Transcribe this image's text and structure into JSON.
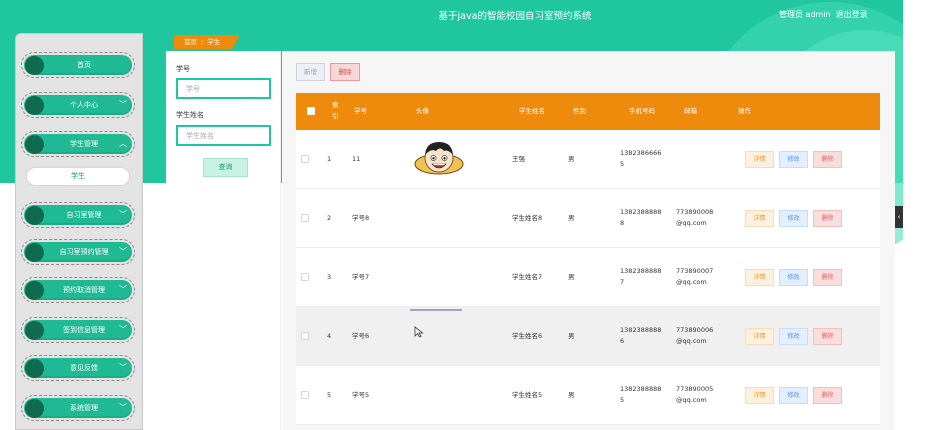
{
  "header": {
    "title": "基于java的智能校园自习室预约系统",
    "user_role": "管理员 admin",
    "logout_label": "退出登录"
  },
  "sidebar": {
    "items": [
      {
        "label": "首页",
        "has_arrow": false
      },
      {
        "label": "个人中心",
        "has_arrow": true
      },
      {
        "label": "学生管理",
        "has_arrow": true,
        "expanded": true
      },
      {
        "label": "自习室管理",
        "has_arrow": true
      },
      {
        "label": "自习室预约管理",
        "has_arrow": true
      },
      {
        "label": "预约取消管理",
        "has_arrow": true
      },
      {
        "label": "签到信息管理",
        "has_arrow": true
      },
      {
        "label": "意见反馈",
        "has_arrow": true
      },
      {
        "label": "系统管理",
        "has_arrow": true
      }
    ],
    "sub_item_label": "学生"
  },
  "breadcrumb": {
    "home": "首页",
    "separator": ":",
    "current": "学生"
  },
  "search": {
    "student_no_label": "学号",
    "student_no_placeholder": "学号",
    "student_name_label": "学生姓名",
    "student_name_placeholder": "学生姓名",
    "query_button": "查询"
  },
  "toolbar": {
    "add_label": "新增",
    "delete_label": "删除"
  },
  "table": {
    "headers": {
      "index": "索引",
      "student_no": "学号",
      "avatar": "头像",
      "student_name": "学生姓名",
      "gender": "性别",
      "phone": "手机号码",
      "email": "邮箱",
      "actions": "操作"
    },
    "action_labels": {
      "detail": "详情",
      "edit": "修改",
      "delete": "删除"
    },
    "rows": [
      {
        "index": "1",
        "student_no": "11",
        "student_name": "王强",
        "gender": "男",
        "phone_1": "1382386666",
        "phone_2": "5",
        "email_1": "",
        "email_2": ""
      },
      {
        "index": "2",
        "student_no": "学号8",
        "student_name": "学生姓名8",
        "gender": "男",
        "phone_1": "1382388888",
        "phone_2": "8",
        "email_1": "773890008",
        "email_2": "@qq.com"
      },
      {
        "index": "3",
        "student_no": "学号7",
        "student_name": "学生姓名7",
        "gender": "男",
        "phone_1": "1382388888",
        "phone_2": "7",
        "email_1": "773890007",
        "email_2": "@qq.com"
      },
      {
        "index": "4",
        "student_no": "学号6",
        "student_name": "学生姓名6",
        "gender": "男",
        "phone_1": "1382388888",
        "phone_2": "6",
        "email_1": "773890006",
        "email_2": "@qq.com"
      },
      {
        "index": "5",
        "student_no": "学号5",
        "student_name": "学生姓名5",
        "gender": "男",
        "phone_1": "1382388888",
        "phone_2": "5",
        "email_1": "773890005",
        "email_2": "@qq.com"
      }
    ]
  },
  "colors": {
    "accent": "#20c79e",
    "sidebar_pill": "#1fba93",
    "table_header": "#ee8a0c"
  },
  "icons": {
    "sidebar_dot": "circle-icon",
    "sidebar_arrow": "chevron-down-icon",
    "collapse": "chevron-left-icon",
    "avatar": "cartoon-avatar-icon",
    "cursor": "mouse-cursor-icon"
  }
}
